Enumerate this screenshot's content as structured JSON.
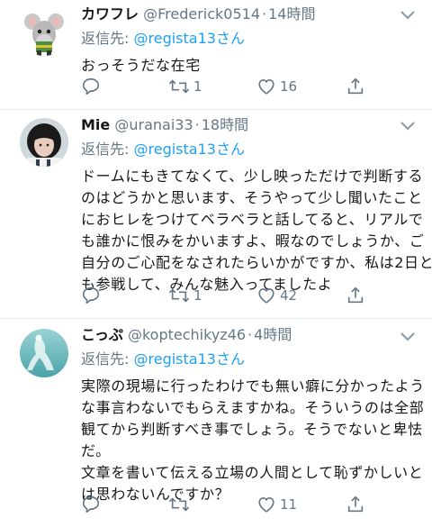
{
  "tweets": [
    {
      "name": "カワフレ",
      "handle": "@Frederick0514",
      "dot": "·",
      "time": "14時間",
      "reply_prefix": "返信先:",
      "reply_handle": "@regista13さん",
      "lines": [
        "おっそうだな在宅"
      ],
      "retweet_count": "1",
      "like_count": "16",
      "avatar_icon": "rat-figure-avatar"
    },
    {
      "name": "Mie",
      "handle": "@uranai33",
      "dot": "·",
      "time": "18時間",
      "reply_prefix": "返信先:",
      "reply_handle": "@regista13さん",
      "lines": [
        "ドームにもきてなくて、少し映っただけで判断する",
        "のはどうかと思います、そうやって少し聞いたこと",
        "におヒレをつけてベラベラと話してると、リアルで",
        "も誰かに恨みをかいますよ、暇なのでしょうか、ご",
        "自分のご心配をなされたらいかがですか、私は2日と",
        "も参戦して、みんな魅入ってましたよ"
      ],
      "retweet_count": "1",
      "like_count": "42",
      "avatar_icon": "person-photo-avatar"
    },
    {
      "name": "こっぷ",
      "handle": "@koptechikyz46",
      "dot": "·",
      "time": "4時間",
      "reply_prefix": "返信先:",
      "reply_handle": "@regista13さん",
      "lines": [
        "実際の現場に行ったわけでも無い癖に分かったよう",
        "な事言わないでもらえますかね。そういうのは全部",
        "観てから判断すべき事でしょう。そうでないと卑怯",
        "だ。",
        "文章を書いて伝える立場の人間として恥ずかしいと",
        "は思わないんですか？"
      ],
      "retweet_count": "",
      "like_count": "11",
      "avatar_icon": "teal-figure-avatar"
    }
  ],
  "colors": {
    "accent": "#1da1f2",
    "secondary_text": "#657786",
    "primary_text": "#14171a",
    "divider": "#e6ecf0"
  }
}
